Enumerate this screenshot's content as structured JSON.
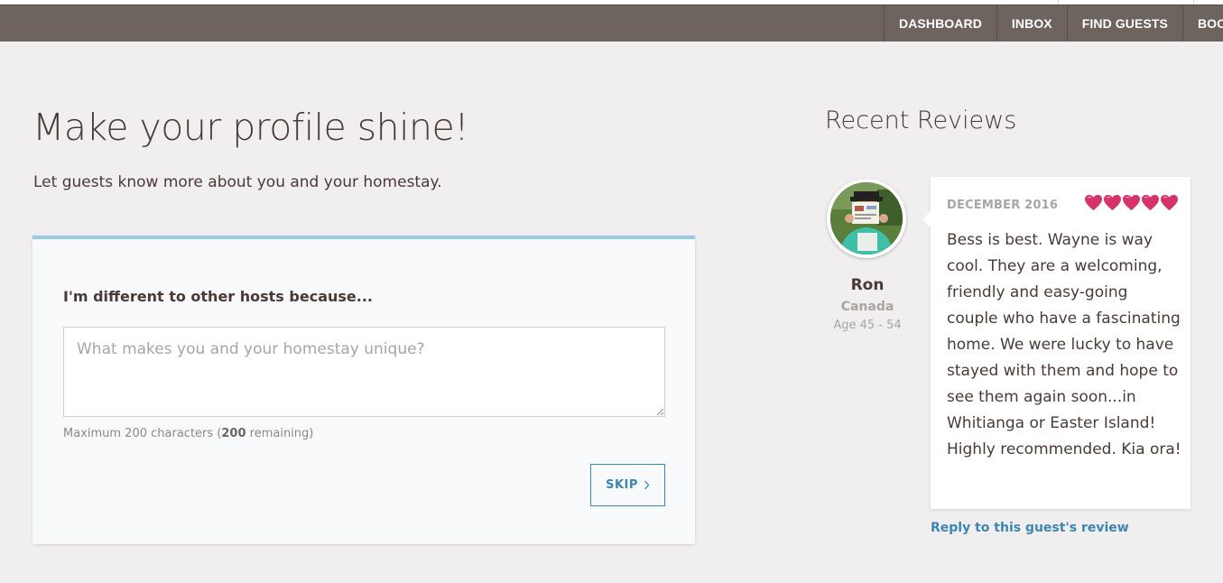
{
  "nav": {
    "items": [
      "DASHBOARD",
      "INBOX",
      "FIND GUESTS",
      "BOOK"
    ]
  },
  "profile": {
    "title": "Make your profile shine!",
    "subtitle": "Let guests know more about you and your homestay."
  },
  "form": {
    "label": "I'm different to other hosts because...",
    "placeholder": "What makes you and your homestay unique?",
    "value": "",
    "hint_prefix": "Maximum 200 characters (",
    "remaining": "200",
    "hint_suffix": " remaining)",
    "skip_label": "SKIP"
  },
  "reviews": {
    "title": "Recent Reviews",
    "reviewer": {
      "name": "Ron",
      "country": "Canada",
      "age": "Age 45 - 54"
    },
    "date": "DECEMBER 2016",
    "rating": 5,
    "text": "Bess is best. Wayne is way cool. They are a welcoming, friendly and easy-going couple who have a fascinating home. We were lucky to have stayed with them and hope to see them again soon...in Whitianga or Easter Island! Highly recommended. Kia ora!",
    "reply_label": "Reply to this guest's review"
  },
  "colors": {
    "navbar": "#6e645f",
    "accent_blue": "#3a86b4",
    "card_top_border": "#9bc8e6",
    "heart": "#d6336c"
  },
  "icons": {
    "skip": "chevron-right-icon",
    "rating": "heart-icon"
  }
}
